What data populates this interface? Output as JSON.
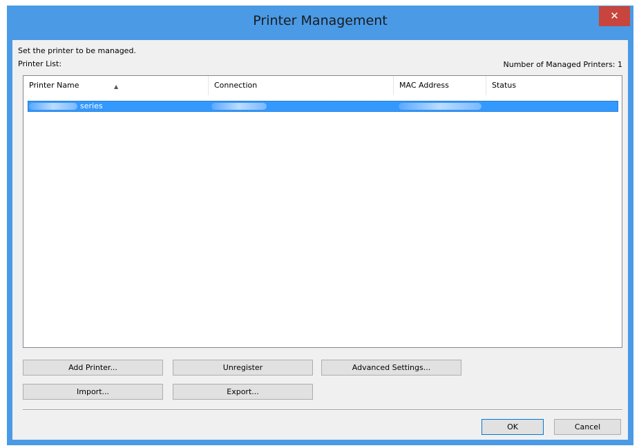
{
  "window": {
    "title": "Printer Management",
    "close_label": "✕"
  },
  "instructions": "Set the printer to be managed.",
  "printer_list_label": "Printer List:",
  "managed_count": "Number of Managed Printers: 1",
  "columns": [
    "Printer Name",
    "Connection",
    "MAC Address",
    "Status"
  ],
  "sort_indicator": "▲",
  "rows": [
    {
      "printer_name": "series",
      "connection": "",
      "mac_address": "",
      "status": ""
    }
  ],
  "buttons": {
    "add_printer": "Add Printer...",
    "unregister": "Unregister",
    "advanced_settings": "Advanced Settings...",
    "import": "Import...",
    "export": "Export...",
    "ok": "OK",
    "cancel": "Cancel"
  },
  "colors": {
    "titlebar": "#4a9ae6",
    "close": "#c7453c",
    "selection": "#3399ff"
  }
}
